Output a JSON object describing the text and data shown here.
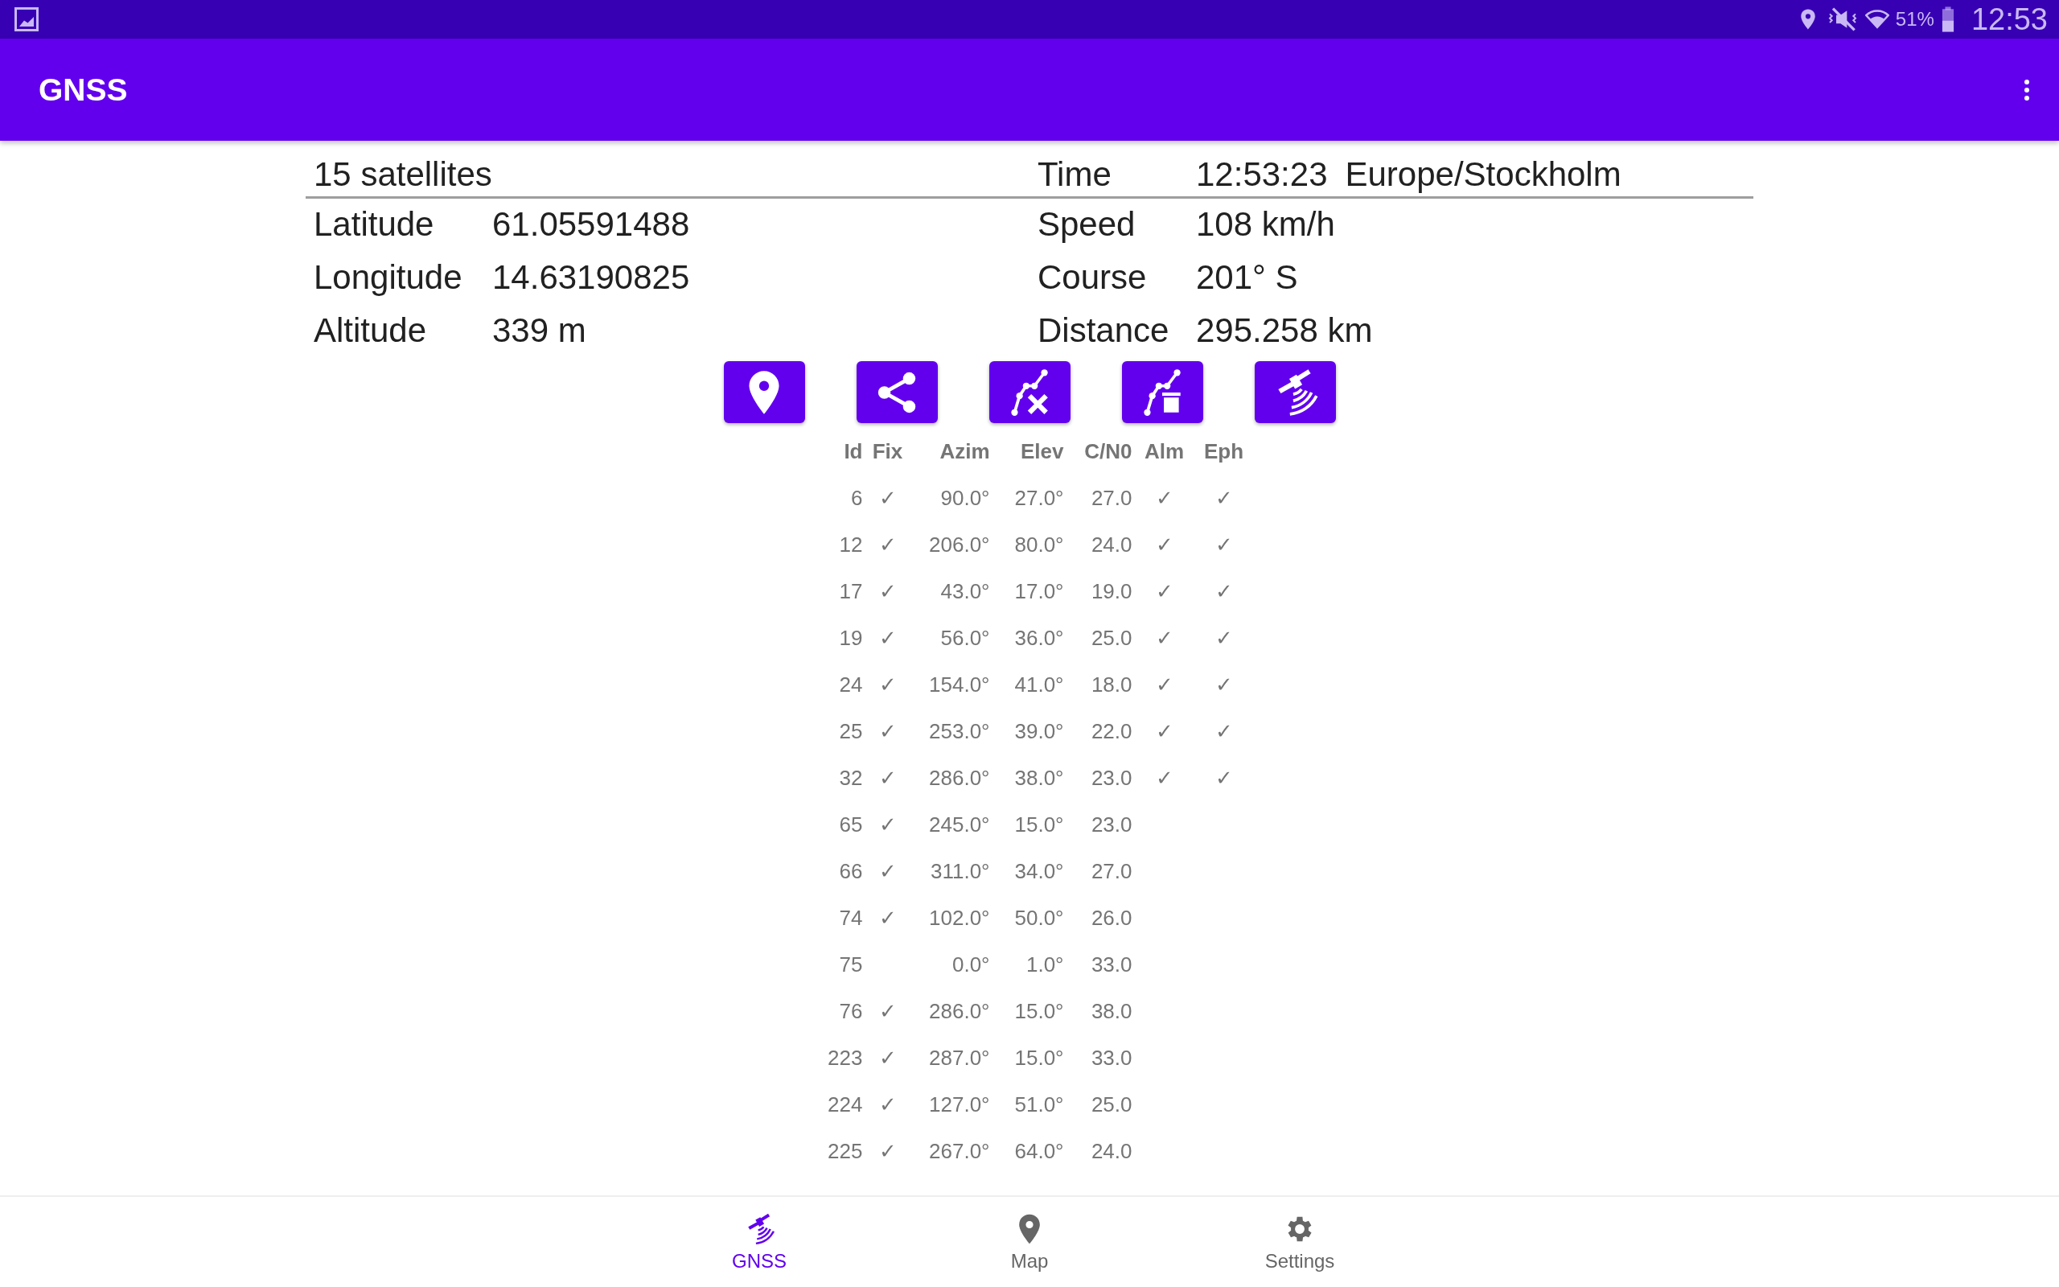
{
  "status_bar": {
    "battery": "51%",
    "time": "12:53"
  },
  "app_bar": {
    "title": "GNSS"
  },
  "summary": {
    "satellites": "15 satellites",
    "time_label": "Time",
    "time_value": "12:53:23",
    "timezone": "Europe/Stockholm",
    "left_fields": [
      {
        "label": "Latitude",
        "value": "61.05591488"
      },
      {
        "label": "Longitude",
        "value": "14.63190825"
      },
      {
        "label": "Altitude",
        "value": "339 m"
      }
    ],
    "right_fields": [
      {
        "label": "Speed",
        "value": "108 km/h"
      },
      {
        "label": "Course",
        "value": "201° S"
      },
      {
        "label": "Distance",
        "value": "295.258 km"
      }
    ]
  },
  "toolbar": [
    {
      "kind": "pin"
    },
    {
      "kind": "share"
    },
    {
      "kind": "track-clear"
    },
    {
      "kind": "track-delete"
    },
    {
      "kind": "satellite"
    }
  ],
  "table": {
    "columns": [
      "Id",
      "Fix",
      "Azim",
      "Elev",
      "C/N0",
      "Alm",
      "Eph"
    ],
    "rows": [
      {
        "id": "6",
        "fix": "✓",
        "azim": "90.0°",
        "elev": "27.0°",
        "cn0": "27.0",
        "alm": "✓",
        "eph": "✓"
      },
      {
        "id": "12",
        "fix": "✓",
        "azim": "206.0°",
        "elev": "80.0°",
        "cn0": "24.0",
        "alm": "✓",
        "eph": "✓"
      },
      {
        "id": "17",
        "fix": "✓",
        "azim": "43.0°",
        "elev": "17.0°",
        "cn0": "19.0",
        "alm": "✓",
        "eph": "✓"
      },
      {
        "id": "19",
        "fix": "✓",
        "azim": "56.0°",
        "elev": "36.0°",
        "cn0": "25.0",
        "alm": "✓",
        "eph": "✓"
      },
      {
        "id": "24",
        "fix": "✓",
        "azim": "154.0°",
        "elev": "41.0°",
        "cn0": "18.0",
        "alm": "✓",
        "eph": "✓"
      },
      {
        "id": "25",
        "fix": "✓",
        "azim": "253.0°",
        "elev": "39.0°",
        "cn0": "22.0",
        "alm": "✓",
        "eph": "✓"
      },
      {
        "id": "32",
        "fix": "✓",
        "azim": "286.0°",
        "elev": "38.0°",
        "cn0": "23.0",
        "alm": "✓",
        "eph": "✓"
      },
      {
        "id": "65",
        "fix": "✓",
        "azim": "245.0°",
        "elev": "15.0°",
        "cn0": "23.0"
      },
      {
        "id": "66",
        "fix": "✓",
        "azim": "311.0°",
        "elev": "34.0°",
        "cn0": "27.0"
      },
      {
        "id": "74",
        "fix": "✓",
        "azim": "102.0°",
        "elev": "50.0°",
        "cn0": "26.0"
      },
      {
        "id": "75",
        "azim": "0.0°",
        "elev": "1.0°",
        "cn0": "33.0"
      },
      {
        "id": "76",
        "fix": "✓",
        "azim": "286.0°",
        "elev": "15.0°",
        "cn0": "38.0"
      },
      {
        "id": "223",
        "fix": "✓",
        "azim": "287.0°",
        "elev": "15.0°",
        "cn0": "33.0"
      },
      {
        "id": "224",
        "fix": "✓",
        "azim": "127.0°",
        "elev": "51.0°",
        "cn0": "25.0"
      },
      {
        "id": "225",
        "fix": "✓",
        "azim": "267.0°",
        "elev": "64.0°",
        "cn0": "24.0"
      }
    ]
  },
  "bottom_nav": [
    {
      "label": "GNSS",
      "kind": "satellite",
      "selected": true
    },
    {
      "label": "Map",
      "kind": "pin",
      "selected": false
    },
    {
      "label": "Settings",
      "kind": "gear",
      "selected": false
    }
  ]
}
